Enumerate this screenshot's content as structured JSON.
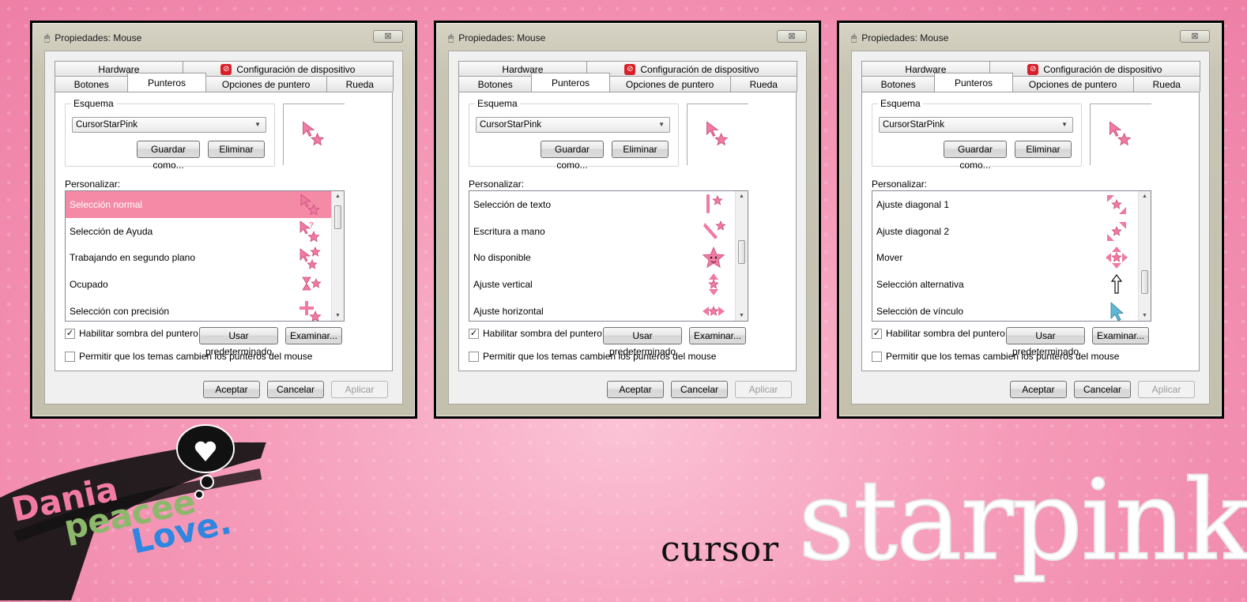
{
  "colors": {
    "selection": "#f48aa6",
    "background": "#f59ab8",
    "cursor_pink": "#f17aa2"
  },
  "dialogs": [
    {
      "title": "Propiedades: Mouse",
      "close": "⊠",
      "tabs_back": [
        "Hardware",
        "Configuración de dispositivo"
      ],
      "tabs_front": [
        "Botones",
        "Punteros",
        "Opciones de puntero",
        "Rueda"
      ],
      "active_tab": "Punteros",
      "scheme_label": "Esquema",
      "scheme_value": "CursorStarPink",
      "save_button": "Guardar como...",
      "delete_button": "Eliminar",
      "customize_label": "Personalizar:",
      "items": [
        {
          "label": "Selección normal",
          "icon": "arrow-star",
          "selected": true
        },
        {
          "label": "Selección de Ayuda",
          "icon": "help-star"
        },
        {
          "label": "Trabajando en segundo plano",
          "icon": "busy-arrow-star"
        },
        {
          "label": "Ocupado",
          "icon": "hourglass-star"
        },
        {
          "label": "Selección con precisión",
          "icon": "cross-star"
        }
      ],
      "shadow_label": "Habilitar sombra del puntero",
      "shadow_checked": true,
      "default_button": "Usar predeterminado",
      "browse_button": "Examinar...",
      "themes_label": "Permitir que los temas cambien los punteros del mouse",
      "themes_checked": false,
      "ok": "Aceptar",
      "cancel": "Cancelar",
      "apply": "Aplicar"
    },
    {
      "title": "Propiedades: Mouse",
      "close": "⊠",
      "tabs_back": [
        "Hardware",
        "Configuración de dispositivo"
      ],
      "tabs_front": [
        "Botones",
        "Punteros",
        "Opciones de puntero",
        "Rueda"
      ],
      "active_tab": "Punteros",
      "scheme_label": "Esquema",
      "scheme_value": "CursorStarPink",
      "save_button": "Guardar como...",
      "delete_button": "Eliminar",
      "customize_label": "Personalizar:",
      "items": [
        {
          "label": "Selección de texto",
          "icon": "text-star"
        },
        {
          "label": "Escritura a mano",
          "icon": "pen-star"
        },
        {
          "label": "No disponible",
          "icon": "star-face"
        },
        {
          "label": "Ajuste vertical",
          "icon": "vertical-resize-star"
        },
        {
          "label": "Ajuste horizontal",
          "icon": "horizontal-resize-star"
        }
      ],
      "shadow_label": "Habilitar sombra del puntero",
      "shadow_checked": true,
      "default_button": "Usar predeterminado",
      "browse_button": "Examinar...",
      "themes_label": "Permitir que los temas cambien los punteros del mouse",
      "themes_checked": false,
      "ok": "Aceptar",
      "cancel": "Cancelar",
      "apply": "Aplicar"
    },
    {
      "title": "Propiedades: Mouse",
      "close": "⊠",
      "tabs_back": [
        "Hardware",
        "Configuración de dispositivo"
      ],
      "tabs_front": [
        "Botones",
        "Punteros",
        "Opciones de puntero",
        "Rueda"
      ],
      "active_tab": "Punteros",
      "scheme_label": "Esquema",
      "scheme_value": "CursorStarPink",
      "save_button": "Guardar como...",
      "delete_button": "Eliminar",
      "customize_label": "Personalizar:",
      "items": [
        {
          "label": "Ajuste diagonal 1",
          "icon": "diagonal1-star"
        },
        {
          "label": "Ajuste diagonal 2",
          "icon": "diagonal2-star"
        },
        {
          "label": "Mover",
          "icon": "move-star"
        },
        {
          "label": "Selección alternativa",
          "icon": "up-arrow"
        },
        {
          "label": "Selección de vínculo",
          "icon": "link-arrow"
        }
      ],
      "shadow_label": "Habilitar sombra del puntero",
      "shadow_checked": true,
      "default_button": "Usar predeterminado",
      "browse_button": "Examinar...",
      "themes_label": "Permitir que los temas cambien los punteros del mouse",
      "themes_checked": false,
      "ok": "Aceptar",
      "cancel": "Cancelar",
      "apply": "Aplicar"
    }
  ],
  "decor": {
    "signature_line1": "Dania",
    "signature_line2": "peacee",
    "signature_line3": "Love.",
    "cursor_word": "cursor",
    "star_word": "starpink",
    "signature_colors": [
      "#f27ba3",
      "#8bb86b",
      "#2d86e0"
    ]
  }
}
